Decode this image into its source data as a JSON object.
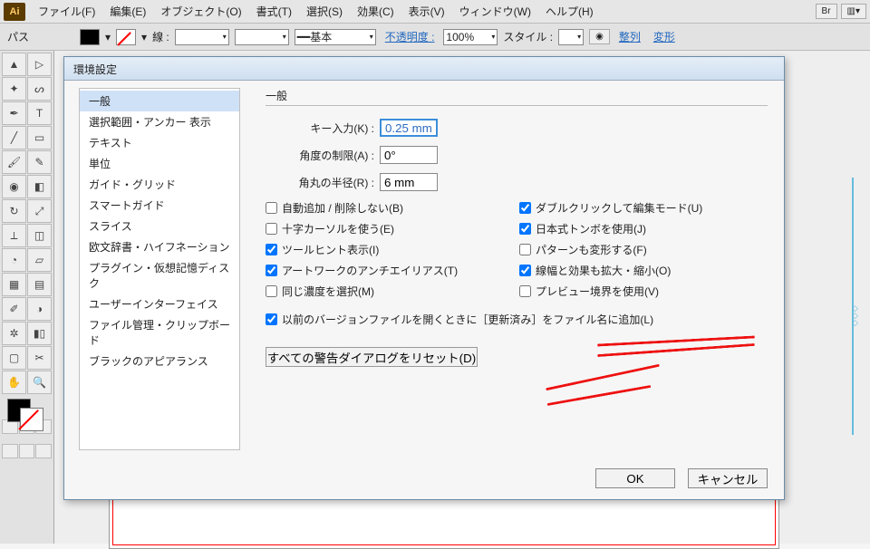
{
  "menubar": {
    "items": [
      "ファイル(F)",
      "編集(E)",
      "オブジェクト(O)",
      "書式(T)",
      "選択(S)",
      "効果(C)",
      "表示(V)",
      "ウィンドウ(W)",
      "ヘルプ(H)"
    ],
    "logo": "Ai",
    "right": [
      "Br"
    ]
  },
  "optionbar": {
    "left": "パス",
    "stroke_label": "線 :",
    "brush_label": "基本",
    "opacity_label": "不透明度 :",
    "opacity_value": "100%",
    "style_label": "スタイル :",
    "links": [
      "整列",
      "変形"
    ]
  },
  "dialog": {
    "title": "環境設定",
    "categories": [
      "一般",
      "選択範囲・アンカー 表示",
      "テキスト",
      "単位",
      "ガイド・グリッド",
      "スマートガイド",
      "スライス",
      "欧文辞書・ハイフネーション",
      "プラグイン・仮想記憶ディスク",
      "ユーザーインターフェイス",
      "ファイル管理・クリップボード",
      "ブラックのアピアランス"
    ],
    "selected": 0,
    "section": "一般",
    "key_label": "キー入力(K) :",
    "key_value": "0.25 mm",
    "angle_label": "角度の制限(A) :",
    "angle_value": "0°",
    "corner_label": "角丸の半径(R) :",
    "corner_value": "6 mm",
    "checks_left": [
      {
        "label": "自動追加 / 削除しない(B)",
        "checked": false
      },
      {
        "label": "十字カーソルを使う(E)",
        "checked": false
      },
      {
        "label": "ツールヒント表示(I)",
        "checked": true
      },
      {
        "label": "アートワークのアンチエイリアス(T)",
        "checked": true
      },
      {
        "label": "同じ濃度を選択(M)",
        "checked": false
      }
    ],
    "checks_right": [
      {
        "label": "ダブルクリックして編集モード(U)",
        "checked": true
      },
      {
        "label": "日本式トンボを使用(J)",
        "checked": true
      },
      {
        "label": "パターンも変形する(F)",
        "checked": false
      },
      {
        "label": "線幅と効果も拡大・縮小(O)",
        "checked": true
      },
      {
        "label": "プレビュー境界を使用(V)",
        "checked": false
      }
    ],
    "legacy": {
      "label": "以前のバージョンファイルを開くときに［更新済み］をファイル名に追加(L)",
      "checked": true
    },
    "reset": "すべての警告ダイアログをリセット(D)",
    "ok": "OK",
    "cancel": "キャンセル"
  }
}
